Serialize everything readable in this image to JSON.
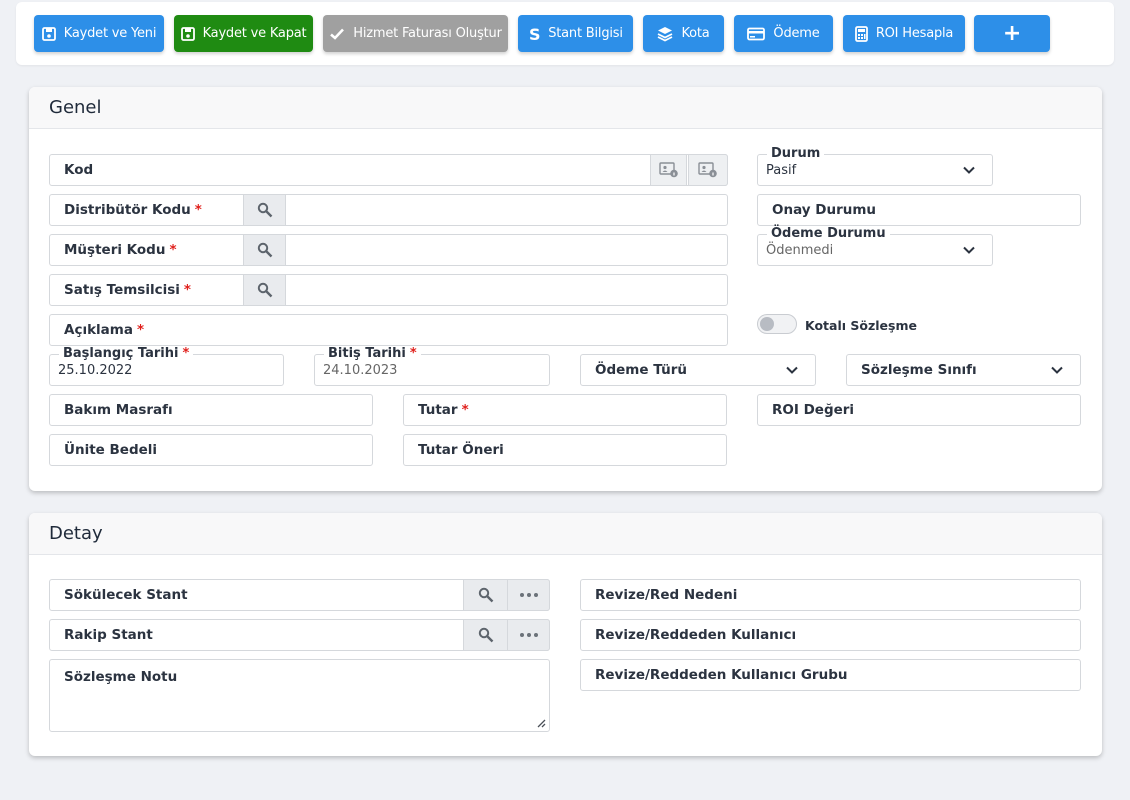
{
  "toolbar": {
    "save_new": "Kaydet ve Yeni",
    "save_close": "Kaydet ve Kapat",
    "create_invoice": "Hizmet Faturası Oluştur",
    "stand_info": "Stant Bilgisi",
    "quota": "Kota",
    "payment": "Ödeme",
    "roi_calc": "ROI Hesapla",
    "add": "+"
  },
  "general": {
    "title": "Genel",
    "code_label": "Kod",
    "status": {
      "label": "Durum",
      "value": "Pasif"
    },
    "distributor_code_label": "Distribütör Kodu",
    "approval_status_label": "Onay Durumu",
    "customer_code_label": "Müşteri Kodu",
    "payment_status": {
      "label": "Ödeme Durumu",
      "value": "Ödenmedi"
    },
    "sales_rep_label": "Satış Temsilcisi",
    "description_label": "Açıklama",
    "quota_contract_label": "Kotalı Sözleşme",
    "start_date": {
      "label": "Başlangıç Tarihi",
      "value": "25.10.2022"
    },
    "end_date": {
      "label": "Bitiş Tarihi",
      "value": "24.10.2023"
    },
    "payment_type_label": "Ödeme Türü",
    "contract_class_label": "Sözleşme Sınıfı",
    "maintenance_cost_label": "Bakım Masrafı",
    "amount_label": "Tutar",
    "roi_value_label": "ROI Değeri",
    "unit_price_label": "Ünite Bedeli",
    "amount_suggestion_label": "Tutar Öneri",
    "required_mark": "*"
  },
  "detail": {
    "title": "Detay",
    "removed_stand_label": "Sökülecek Stant",
    "rival_stand_label": "Rakip Stant",
    "contract_note_label": "Sözleşme Notu",
    "revise_reason_label": "Revize/Red Nedeni",
    "revise_user_label": "Revize/Reddeden Kullanıcı",
    "revise_group_label": "Revize/Reddeden Kullanıcı Grubu"
  },
  "colors": {
    "primary": "#2d8fe8",
    "success": "#1f8b12",
    "disabled": "#a0a0a0",
    "required": "#e0201c"
  }
}
